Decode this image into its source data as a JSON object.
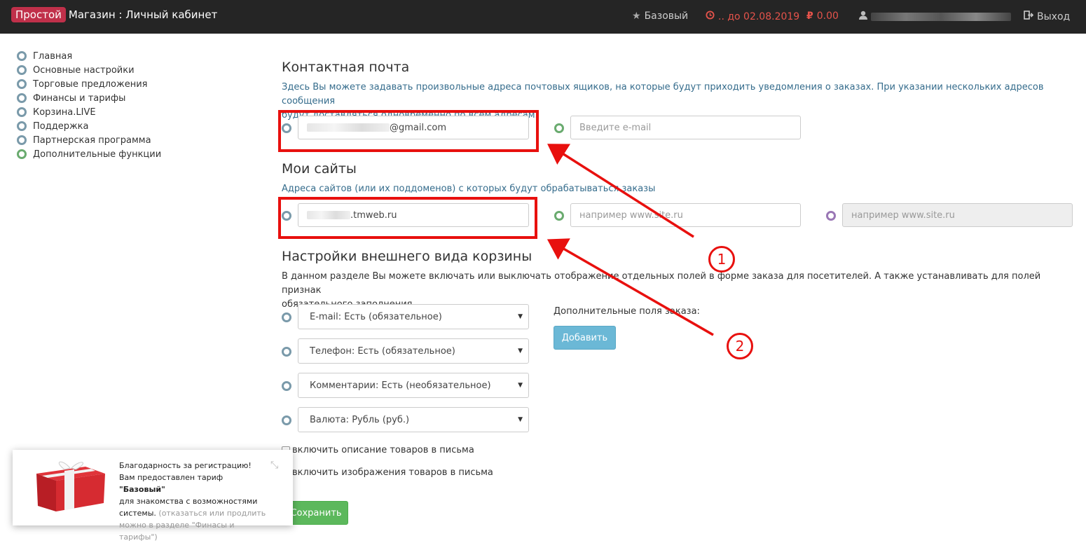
{
  "header": {
    "brand_badge": "Простой",
    "brand_name": "Магазин : Личный кабинет",
    "plan": "Базовый",
    "until": ".. до 02.08.2019",
    "balance": "0.00",
    "logout": "Выход",
    "accent_color": "#c0304a",
    "warn_color": "#e5534b"
  },
  "sidebar": {
    "items": [
      {
        "label": "Главная"
      },
      {
        "label": "Основные настройки"
      },
      {
        "label": "Торговые предложения"
      },
      {
        "label": "Финансы и тарифы"
      },
      {
        "label": "Корзина.LIVE"
      },
      {
        "label": "Поддержка"
      },
      {
        "label": "Партнерская программа"
      },
      {
        "label": "Дополнительные функции"
      }
    ]
  },
  "contact": {
    "title": "Контактная почта",
    "desc1": "Здесь Вы можете задавать произвольные адреса почтовых ящиков, на которые будут приходить уведомления о заказах. При указании нескольких адресов сообщения",
    "desc2": "будут доставляться одновременно по всем адресам.",
    "email_value": "@gmail.com",
    "email_placeholder": "Введите e-mail"
  },
  "sites": {
    "title": "Мои сайты",
    "desc": "Адреса сайтов (или их поддоменов) с которых будут обрабатываться заказы",
    "site_value": ".tmweb.ru",
    "site_placeholder": "например www.site.ru",
    "site_placeholder_disabled": "например www.site.ru"
  },
  "cart": {
    "title": "Настройки внешнего вида корзины",
    "desc1": "В данном разделе Вы можете включать или выключать отображение отдельных полей в форме заказа для посетителей. А также устанавливать для полей признак",
    "desc2": "обязательного заполнения.",
    "selects": [
      {
        "value": "E-mail: Есть (обязательное)"
      },
      {
        "value": "Телефон: Есть (обязательное)"
      },
      {
        "value": "Комментарии: Есть (необязательное)"
      },
      {
        "value": "Валюта: Рубль (руб.)"
      }
    ],
    "extra_label": "Дополнительные поля заказа:",
    "add_button": "Добавить",
    "check_desc": "включить описание товаров в письма",
    "check_images": "включить изображения товаров в письма",
    "save_button": "Сохранить"
  },
  "toast": {
    "line1": "Благодарность за регистрацию!",
    "line2a": "Вам предоставлен тариф ",
    "line2b": "\"Базовый\"",
    "line3": "для знакомства с возможностями",
    "line4": "системы.",
    "muted": "(отказаться или продлить можно в разделе \"Финасы и тарифы\")",
    "close": "⤡"
  },
  "annotations": {
    "n1": "1",
    "n2": "2",
    "color": "#e8100e"
  }
}
